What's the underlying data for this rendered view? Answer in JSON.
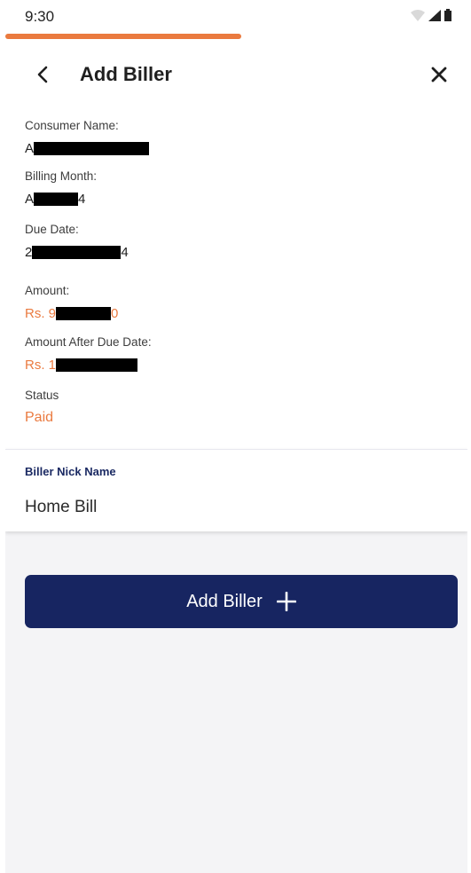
{
  "status_bar": {
    "time": "9:30"
  },
  "progress": {
    "fraction": 0.51,
    "color": "#ea7a3f"
  },
  "header": {
    "title": "Add Biller",
    "back_icon": "chevron-left-icon",
    "close_icon": "close-icon"
  },
  "details": {
    "consumer_name": {
      "label": "Consumer Name:",
      "prefix": "A",
      "suffix": ""
    },
    "billing_month": {
      "label": "Billing Month:",
      "prefix": "A",
      "suffix": "4"
    },
    "due_date": {
      "label": "Due Date:",
      "prefix": "2",
      "suffix": "4"
    },
    "amount": {
      "label": "Amount:",
      "prefix": "Rs. 9",
      "suffix": "0"
    },
    "amount_after_due": {
      "label": "Amount After Due Date:",
      "prefix": "Rs. 1",
      "suffix": ""
    },
    "status": {
      "label": "Status",
      "value": "Paid"
    }
  },
  "nick_name": {
    "label": "Biller Nick Name",
    "value": "Home Bill"
  },
  "action": {
    "label": "Add Biller",
    "icon": "plus-icon"
  },
  "colors": {
    "accent": "#ea7a3f",
    "primary": "#172561"
  }
}
